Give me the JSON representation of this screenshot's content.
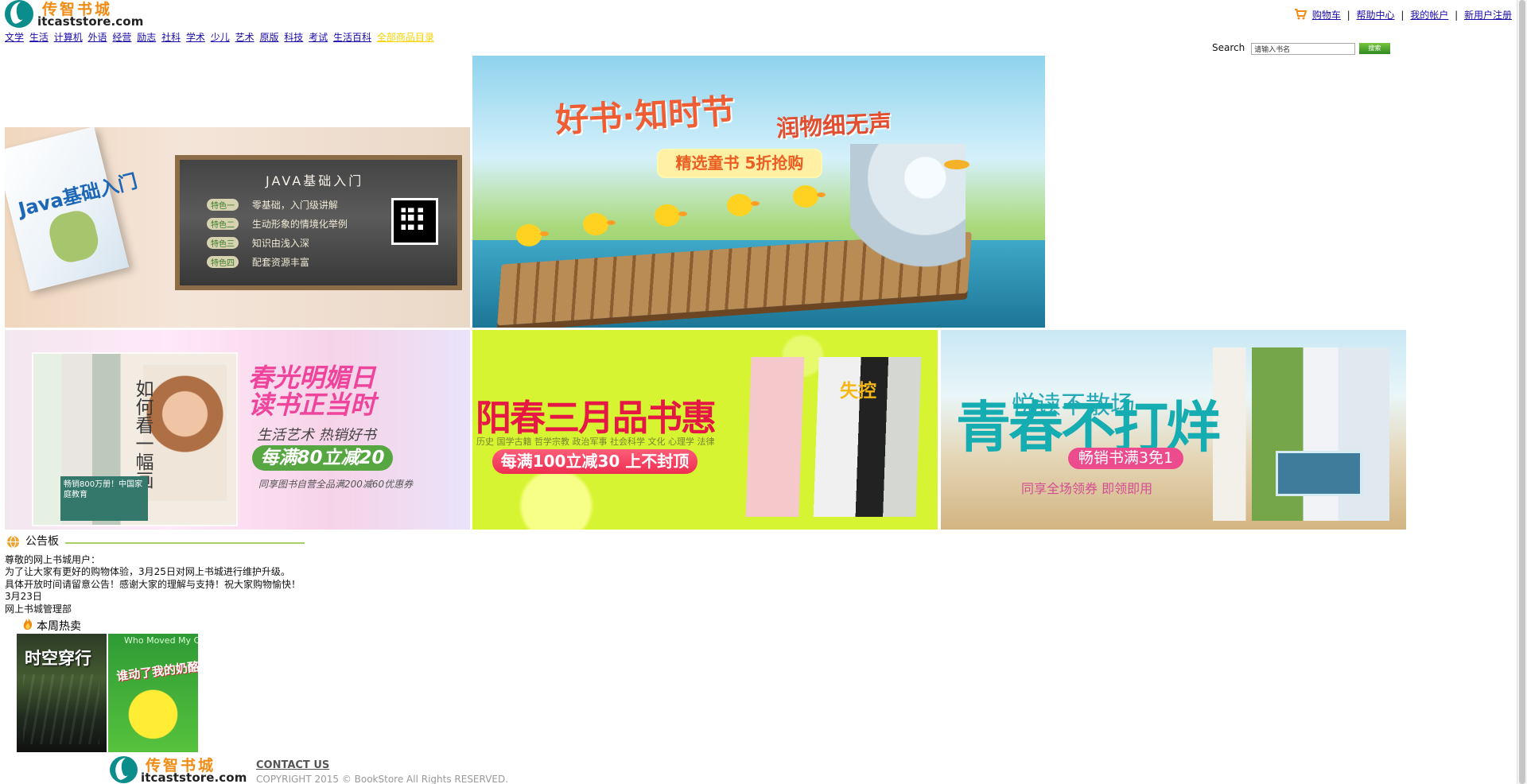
{
  "logo": {
    "cn": "传智书城",
    "en": "itcaststore.com"
  },
  "top_links": [
    {
      "label": "购物车"
    },
    {
      "label": "帮助中心"
    },
    {
      "label": "我的帐户"
    },
    {
      "label": "新用户注册"
    }
  ],
  "top_separator": "|",
  "nav": [
    {
      "label": "文学"
    },
    {
      "label": "生活"
    },
    {
      "label": "计算机"
    },
    {
      "label": "外语"
    },
    {
      "label": "经营"
    },
    {
      "label": "励志"
    },
    {
      "label": "社科"
    },
    {
      "label": "学术"
    },
    {
      "label": "少儿"
    },
    {
      "label": "艺术"
    },
    {
      "label": "原版"
    },
    {
      "label": "科技"
    },
    {
      "label": "考试"
    },
    {
      "label": "生活百科"
    },
    {
      "label": "全部商品目录"
    }
  ],
  "search": {
    "label": "Search",
    "value": "请输入书名",
    "button": "搜索"
  },
  "banners": {
    "java": {
      "book_title": "Java基础入门",
      "board_title": "JAVA基础入门",
      "features": [
        {
          "tag": "特色一",
          "text": "零基础，入门级讲解"
        },
        {
          "tag": "特色二",
          "text": "生动形象的情境化举例"
        },
        {
          "tag": "特色三",
          "text": "知识由浅入深"
        },
        {
          "tag": "特色四",
          "text": "配套资源丰富"
        }
      ]
    },
    "children": {
      "headline": "好书·知时节",
      "headline2": "润物细无声",
      "promo": "精选童书 5折抢购"
    },
    "spring": {
      "vertical_title": "如何看一幅画",
      "small_book": "畅销800万册！中国家庭教育",
      "headline_1": "春光明媚日",
      "headline_2": "读书正当时",
      "subtitle": "生活艺术 热销好书",
      "promo": "每满80立减20",
      "note": "同享图书自营全品满200减60优惠券"
    },
    "march": {
      "headline": "阳春三月品书惠",
      "categories": "历史 国学古籍 哲学宗教 政治军事 社会科学 文化 心理学 法律",
      "promo": "每满100立减30 上不封顶",
      "book_word": "失控"
    },
    "youth": {
      "small": "悦读不散场",
      "big": "青春不打烊",
      "promo": "畅销书满3免1",
      "subtitle": "同享全场领券 即领即用"
    }
  },
  "notice": {
    "title": "公告板",
    "lines": [
      "尊敬的网上书城用户：",
      "为了让大家有更好的购物体验，3月25日对网上书城进行维护升级。",
      "具体开放时间请留意公告！感谢大家的理解与支持！祝大家购物愉快！",
      "3月23日",
      "网上书城管理部"
    ]
  },
  "hot": {
    "title": "本周热卖",
    "books": [
      {
        "title": "时空穿行"
      },
      {
        "title": "谁动了我的奶酪?",
        "top": "Who Moved My Cheese?"
      }
    ]
  },
  "footer": {
    "contact": "CONTACT US",
    "copyright": "COPYRIGHT 2015 © BookStore All Rights RESERVED."
  },
  "colors": {
    "logo_orange": "#f08b14",
    "logo_teal": "#0b8d8b",
    "link": "#1a0dab",
    "nav_all": "#f5d200",
    "notice_line": "#a8cf64"
  }
}
